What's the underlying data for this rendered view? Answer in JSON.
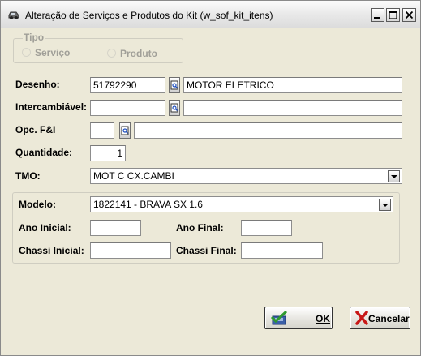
{
  "window": {
    "title": "Alteração de Serviços e Produtos do Kit (w_sof_kit_itens)"
  },
  "tipo": {
    "legend": "Tipo",
    "option_servico": "Serviço",
    "option_produto": "Produto"
  },
  "form": {
    "desenho_label": "Desenho:",
    "desenho_code": "51792290",
    "desenho_desc": "MOTOR ELETRICO",
    "intercambiavel_label": "Intercambiável:",
    "intercambiavel_code": "",
    "intercambiavel_desc": "",
    "opc_label": "Opc. F&I",
    "opc_code": "",
    "opc_desc": "",
    "quantidade_label": "Quantidade:",
    "quantidade_value": "1",
    "tmo_label": "TMO:",
    "tmo_value": "MOT C CX.CAMBI"
  },
  "modelo": {
    "modelo_label": "Modelo:",
    "modelo_value": "1822141 - BRAVA SX 1.6",
    "ano_inicial_label": "Ano Inicial:",
    "ano_inicial_value": "",
    "ano_final_label": "Ano Final:",
    "ano_final_value": "",
    "chassi_inicial_label": "Chassi Inicial:",
    "chassi_inicial_value": "",
    "chassi_final_label": "Chassi Final:",
    "chassi_final_value": ""
  },
  "buttons": {
    "ok_label": "OK",
    "cancel_label": "Cancelar"
  }
}
